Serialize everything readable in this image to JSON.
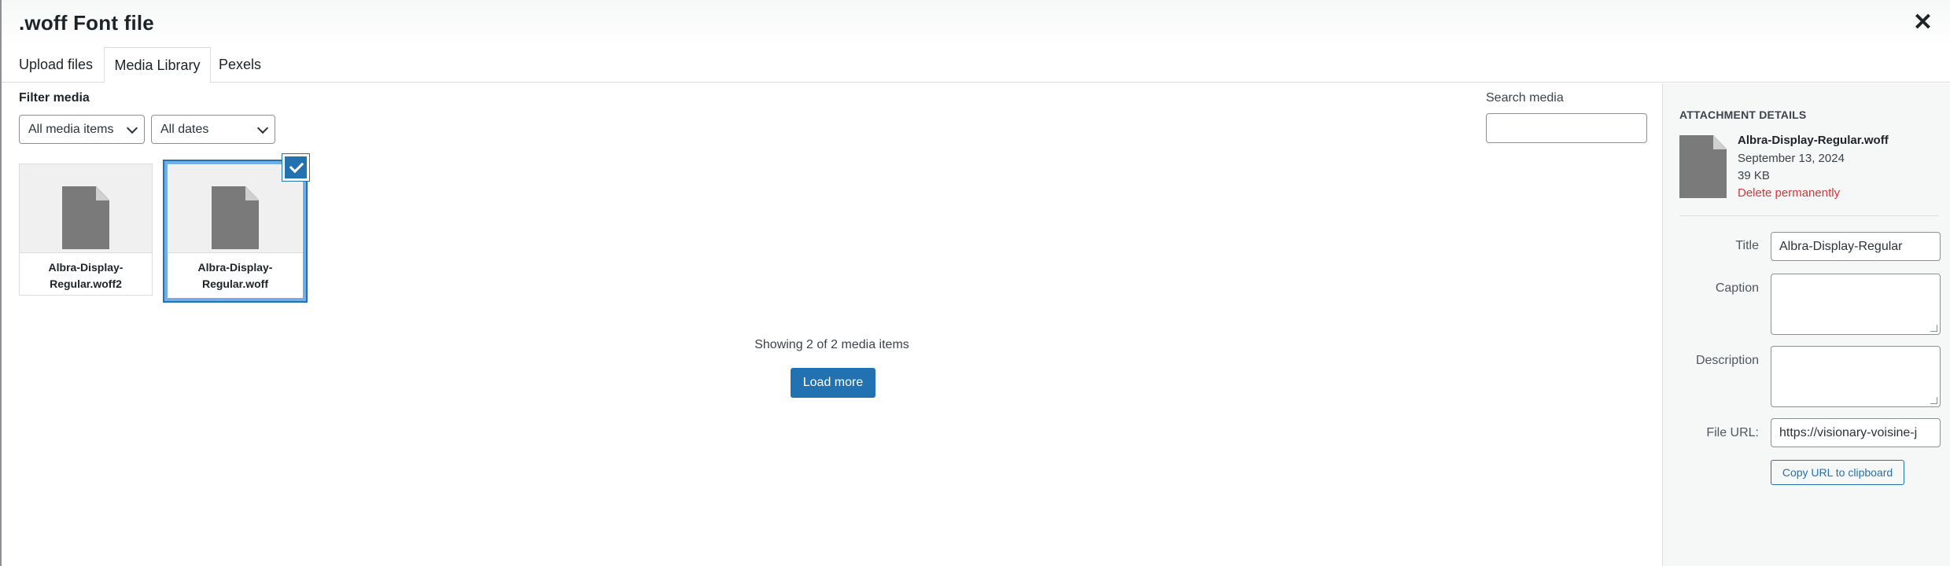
{
  "header": {
    "title": ".woff Font file",
    "close_glyph": "✕"
  },
  "tabs": [
    {
      "label": "Upload files",
      "active": false
    },
    {
      "label": "Media Library",
      "active": true
    },
    {
      "label": "Pexels",
      "active": false
    }
  ],
  "filters": {
    "label": "Filter media",
    "media_type": "All media items",
    "dates": "All dates",
    "search_label": "Search media",
    "search_value": ""
  },
  "attachments": [
    {
      "filename_line1": "Albra-Display-",
      "filename_line2": "Regular.woff2",
      "selected": false
    },
    {
      "filename_line1": "Albra-Display-",
      "filename_line2": "Regular.woff",
      "selected": true
    }
  ],
  "browser": {
    "showing_text": "Showing 2 of 2 media items",
    "load_more_label": "Load more"
  },
  "details": {
    "heading": "Attachment Details",
    "filename": "Albra-Display-Regular.woff",
    "date": "September 13, 2024",
    "size": "39 KB",
    "delete_label": "Delete permanently",
    "title_label": "Title",
    "title_value": "Albra-Display-Regular",
    "caption_label": "Caption",
    "description_label": "Description",
    "file_url_label": "File URL:",
    "file_url_value": "https://visionary-voisine-j",
    "copy_label": "Copy URL to clipboard"
  },
  "colors": {
    "accent": "#2271b1",
    "selection": "#72aee6",
    "delete": "#d63638",
    "file_icon": "#7a7a7a"
  },
  "icons": {
    "close": "close-icon",
    "file": "document-icon",
    "check": "checkmark-icon",
    "chevron": "chevron-down-icon"
  }
}
